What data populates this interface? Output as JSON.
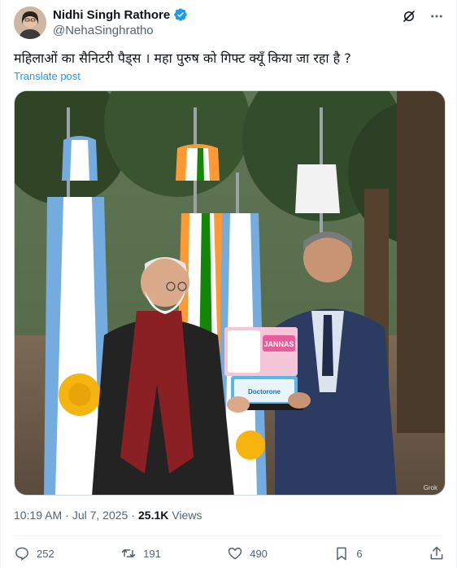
{
  "author": {
    "name": "Nidhi Singh Rathore",
    "handle": "@NehaSinghratho"
  },
  "tweet": {
    "text": "महिलाओं का सैनिटरी पैड्स । महा पुरुष को गिफ्ट क्यूँ किया जा रहा है ?",
    "translate_label": "Translate post"
  },
  "meta": {
    "time": "10:19 AM",
    "sep": "·",
    "date": "Jul 7, 2025",
    "views_count": "25.1K",
    "views_label": "Views"
  },
  "actions": {
    "replies": "252",
    "retweets": "191",
    "likes": "490",
    "bookmarks": "6"
  },
  "media": {
    "package_top_label": "JANNAS",
    "package_bottom_label": "Doctorone",
    "watermark": "Grok"
  },
  "colors": {
    "accent": "#1d9bf0",
    "text": "#0f1419",
    "muted": "#536471"
  },
  "icons": [
    "verified-badge-icon",
    "grok-icon",
    "more-icon",
    "reply-icon",
    "retweet-icon",
    "like-icon",
    "bookmark-icon",
    "share-icon"
  ]
}
